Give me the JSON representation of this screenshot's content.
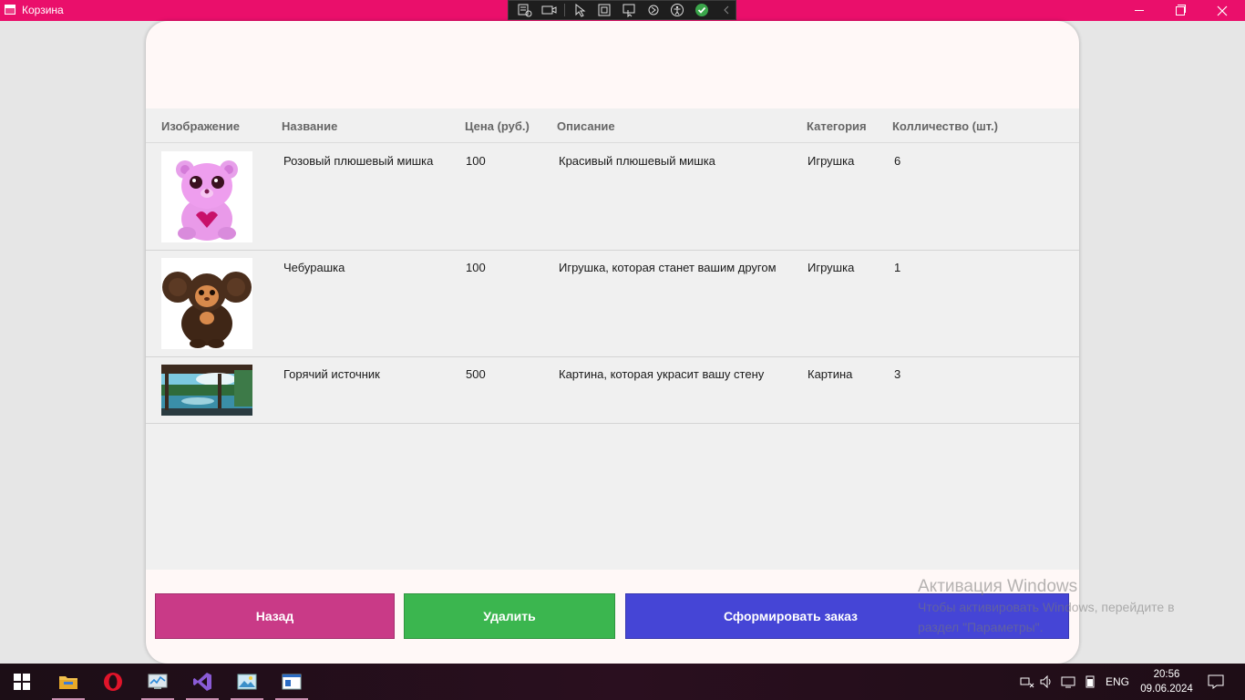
{
  "window": {
    "title": "Корзина"
  },
  "table": {
    "headers": {
      "image": "Изображение",
      "name": "Название",
      "price": "Цена (руб.)",
      "description": "Описание",
      "category": "Категория",
      "quantity": "Колличество (шт.)"
    },
    "rows": [
      {
        "name": "Розовый плюшевый мишка",
        "price": "100",
        "description": "Красивый плюшевый мишка",
        "category": "Игрушка",
        "quantity": "6",
        "image_icon": "pink-teddy-bear-image"
      },
      {
        "name": "Чебурашка",
        "price": "100",
        "description": "Игрушка, которая станет вашим другом",
        "category": "Игрушка",
        "quantity": "1",
        "image_icon": "cheburashka-image"
      },
      {
        "name": "Горячий источник",
        "price": "500",
        "description": "Картина, которая украсит вашу стену",
        "category": "Картина",
        "quantity": "3",
        "image_icon": "hot-spring-painting-image"
      }
    ]
  },
  "buttons": {
    "back": "Назад",
    "delete": "Удалить",
    "order": "Сформировать заказ"
  },
  "watermark": {
    "line1": "Активация Windows",
    "line2": "Чтобы активировать Windows, перейдите в",
    "line3": "раздел \"Параметры\"."
  },
  "taskbar": {
    "apps": [
      "start-icon",
      "file-explorer-icon",
      "opera-icon",
      "task-manager-icon",
      "visual-studio-icon",
      "photos-icon",
      "app-window-icon"
    ],
    "language": "ENG",
    "time": "20:56",
    "date": "09.06.2024"
  },
  "colors": {
    "titlebar": "#ea0f6b",
    "back_button": "#c93a87",
    "delete_button": "#3bb64f",
    "order_button": "#4545d6"
  }
}
